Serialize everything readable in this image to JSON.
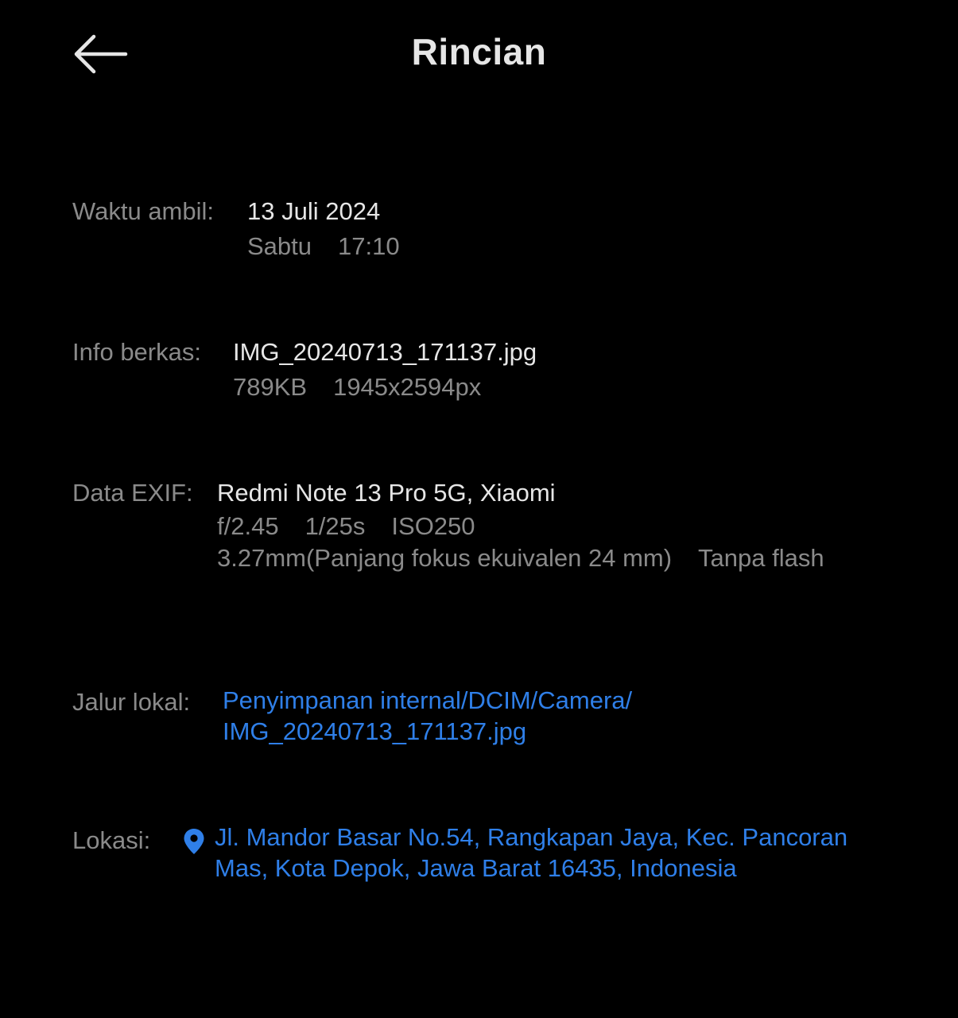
{
  "header": {
    "title": "Rincian",
    "back_icon": "arrow-left-icon"
  },
  "taken_time": {
    "label": "Waktu ambil:",
    "date": "13 Juli 2024",
    "day": "Sabtu",
    "time": "17:10"
  },
  "file_info": {
    "label": "Info berkas:",
    "filename": "IMG_20240713_171137.jpg",
    "size": "789KB",
    "resolution": "1945x2594px"
  },
  "exif": {
    "label": "Data EXIF:",
    "device": "Redmi Note 13 Pro 5G, Xiaomi",
    "aperture": "f/2.45",
    "shutter": "1/25s",
    "iso": "ISO250",
    "focal": "3.27mm(Panjang fokus ekuivalen 24 mm)",
    "flash": "Tanpa flash"
  },
  "local_path": {
    "label": "Jalur lokal:",
    "line1": "Penyimpanan internal/DCIM/Camera/",
    "line2": "IMG_20240713_171137.jpg"
  },
  "location": {
    "label": "Lokasi:",
    "pin_icon": "location-pin-icon",
    "line1": "Jl. Mandor Basar No.54, Rangkapan Jaya, Kec. Pancoran",
    "line2": "Mas, Kota Depok, Jawa Barat 16435, Indonesia"
  },
  "colors": {
    "background": "#000000",
    "primary_text": "#e6e6e6",
    "secondary_text": "#8a8a8a",
    "link": "#2f7fe8"
  }
}
